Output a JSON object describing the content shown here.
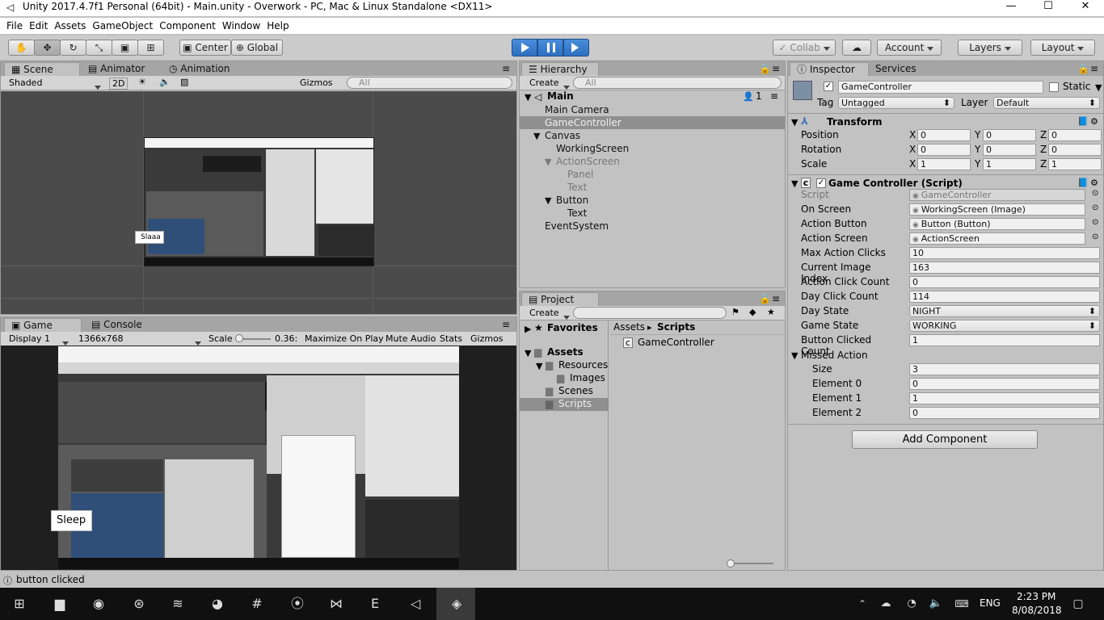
{
  "window": {
    "title": "Unity 2017.4.7f1 Personal (64bit) - Main.unity - Overwork - PC, Mac & Linux Standalone <DX11>",
    "minimize": "—",
    "maximize": "☐",
    "close": "✕"
  },
  "menu": [
    "File",
    "Edit",
    "Assets",
    "GameObject",
    "Component",
    "Window",
    "Help"
  ],
  "toolbar": {
    "pivot": "Center",
    "space": "Global",
    "collab": "Collab",
    "account": "Account",
    "layers": "Layers",
    "layout": "Layout"
  },
  "scene": {
    "tabs": [
      "Scene",
      "Animator",
      "Animation"
    ],
    "shading": "Shaded",
    "mode2d": "2D",
    "gizmos": "Gizmos",
    "search": "All",
    "button_text": "Slaaa"
  },
  "game": {
    "tabs": [
      "Game",
      "Console"
    ],
    "display": "Display 1",
    "resolution": "1366x768",
    "scale_label": "Scale",
    "scale_value": "0.36:",
    "maximize": "Maximize On Play",
    "mute": "Mute Audio",
    "stats": "Stats",
    "gizmos": "Gizmos",
    "button_text": "Sleep"
  },
  "hierarchy": {
    "tab": "Hierarchy",
    "create": "Create",
    "search": "All",
    "scene_name": "Main",
    "scene_count": "1",
    "items": [
      {
        "label": "Main Camera",
        "depth": 1,
        "arrow": "",
        "dim": false,
        "sel": false
      },
      {
        "label": "GameController",
        "depth": 1,
        "arrow": "",
        "dim": false,
        "sel": true
      },
      {
        "label": "Canvas",
        "depth": 1,
        "arrow": "▼",
        "dim": false,
        "sel": false
      },
      {
        "label": "WorkingScreen",
        "depth": 2,
        "arrow": "",
        "dim": false,
        "sel": false
      },
      {
        "label": "ActionScreen",
        "depth": 2,
        "arrow": "▼",
        "dim": true,
        "sel": false
      },
      {
        "label": "Panel",
        "depth": 3,
        "arrow": "",
        "dim": true,
        "sel": false
      },
      {
        "label": "Text",
        "depth": 3,
        "arrow": "",
        "dim": true,
        "sel": false
      },
      {
        "label": "Button",
        "depth": 2,
        "arrow": "▼",
        "dim": false,
        "sel": false
      },
      {
        "label": "Text",
        "depth": 3,
        "arrow": "",
        "dim": false,
        "sel": false
      },
      {
        "label": "EventSystem",
        "depth": 1,
        "arrow": "",
        "dim": false,
        "sel": false
      }
    ]
  },
  "project": {
    "tab": "Project",
    "create": "Create",
    "favorites": "Favorites",
    "assets": "Assets",
    "tree": [
      "Resources",
      "Images",
      "Scenes",
      "Scripts"
    ],
    "breadcrumb_root": "Assets",
    "breadcrumb_current": "Scripts",
    "files": [
      "GameController"
    ]
  },
  "inspector": {
    "tabs": [
      "Inspector",
      "Services"
    ],
    "object_name": "GameController",
    "static_label": "Static",
    "tag_label": "Tag",
    "tag_value": "Untagged",
    "layer_label": "Layer",
    "layer_value": "Default",
    "transform": {
      "title": "Transform",
      "rows": [
        {
          "label": "Position",
          "x": "0",
          "y": "0",
          "z": "0"
        },
        {
          "label": "Rotation",
          "x": "0",
          "y": "0",
          "z": "0"
        },
        {
          "label": "Scale",
          "x": "1",
          "y": "1",
          "z": "1"
        }
      ]
    },
    "script": {
      "title": "Game Controller (Script)",
      "rows": [
        {
          "label": "Script",
          "value": "GameController",
          "kind": "dis",
          "obj": true
        },
        {
          "label": "On Screen",
          "value": "WorkingScreen (Image)",
          "kind": "obj",
          "obj": true
        },
        {
          "label": "Action Button",
          "value": "Button (Button)",
          "kind": "obj",
          "obj": true
        },
        {
          "label": "Action Screen",
          "value": "ActionScreen",
          "kind": "obj",
          "obj": true
        },
        {
          "label": "Max Action Clicks",
          "value": "10",
          "kind": "txt",
          "obj": false
        },
        {
          "label": "Current Image Index",
          "value": "163",
          "kind": "txt",
          "obj": false
        },
        {
          "label": "Action Click Count",
          "value": "0",
          "kind": "txt",
          "obj": false
        },
        {
          "label": "Day Click Count",
          "value": "114",
          "kind": "txt",
          "obj": false
        },
        {
          "label": "Day State",
          "value": "NIGHT",
          "kind": "drop",
          "obj": false
        },
        {
          "label": "Game State",
          "value": "WORKING",
          "kind": "drop",
          "obj": false
        },
        {
          "label": "Button Clicked Count",
          "value": "1",
          "kind": "txt",
          "obj": false
        }
      ],
      "missed_label": "Missed Action",
      "missed_rows": [
        {
          "label": "Size",
          "value": "3"
        },
        {
          "label": "Element 0",
          "value": "0"
        },
        {
          "label": "Element 1",
          "value": "1"
        },
        {
          "label": "Element 2",
          "value": "0"
        }
      ]
    },
    "add_component": "Add Component"
  },
  "status": {
    "message": "button clicked"
  },
  "taskbar": {
    "lang": "ENG",
    "time": "2:23 PM",
    "date": "8/08/2018",
    "apps": [
      "file-explorer-icon",
      "chrome-icon",
      "steam-icon",
      "spotify-icon",
      "discord-icon",
      "slack-icon",
      "maps-icon",
      "visual-studio-icon",
      "epic-games-icon",
      "unity-hub-icon",
      "unity-icon"
    ]
  }
}
